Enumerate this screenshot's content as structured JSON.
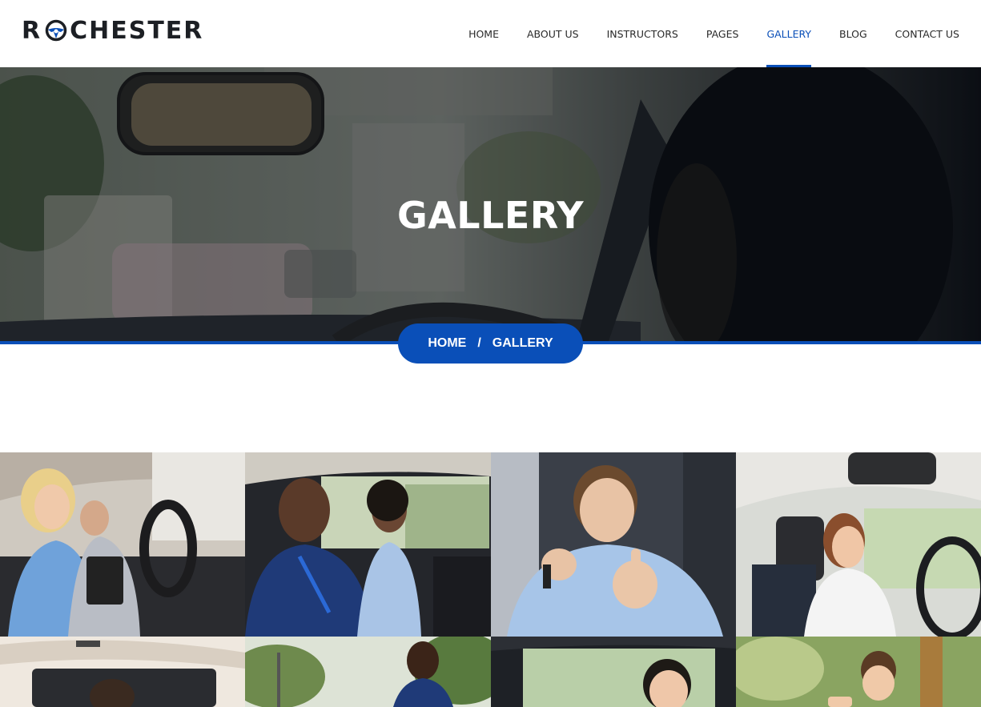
{
  "brand": {
    "logo_text_left": "R",
    "logo_text_right": "CHESTER",
    "logo_icon": "steering-wheel-icon",
    "accent_color": "#0a4fb8"
  },
  "nav": {
    "items": [
      {
        "label": "HOME"
      },
      {
        "label": "ABOUT US"
      },
      {
        "label": "INSTRUCTORS"
      },
      {
        "label": "PAGES"
      },
      {
        "label": "GALLERY",
        "active": true
      },
      {
        "label": "BLOG"
      },
      {
        "label": "CONTACT US"
      }
    ]
  },
  "hero": {
    "title": "GALLERY"
  },
  "breadcrumb": {
    "home": "HOME",
    "separator": "/",
    "current": "GALLERY"
  },
  "gallery": {
    "images": [
      {
        "subject": "woman-driver-with-instructor-photo"
      },
      {
        "subject": "smiling-couple-in-car-photo"
      },
      {
        "subject": "man-holding-car-key-photo"
      },
      {
        "subject": "woman-driving-photo"
      },
      {
        "subject": "man-in-white-car-photo"
      },
      {
        "subject": "instructor-outdoors-photo"
      },
      {
        "subject": "woman-in-car-window-photo"
      },
      {
        "subject": "young-man-outdoors-photo"
      }
    ]
  }
}
